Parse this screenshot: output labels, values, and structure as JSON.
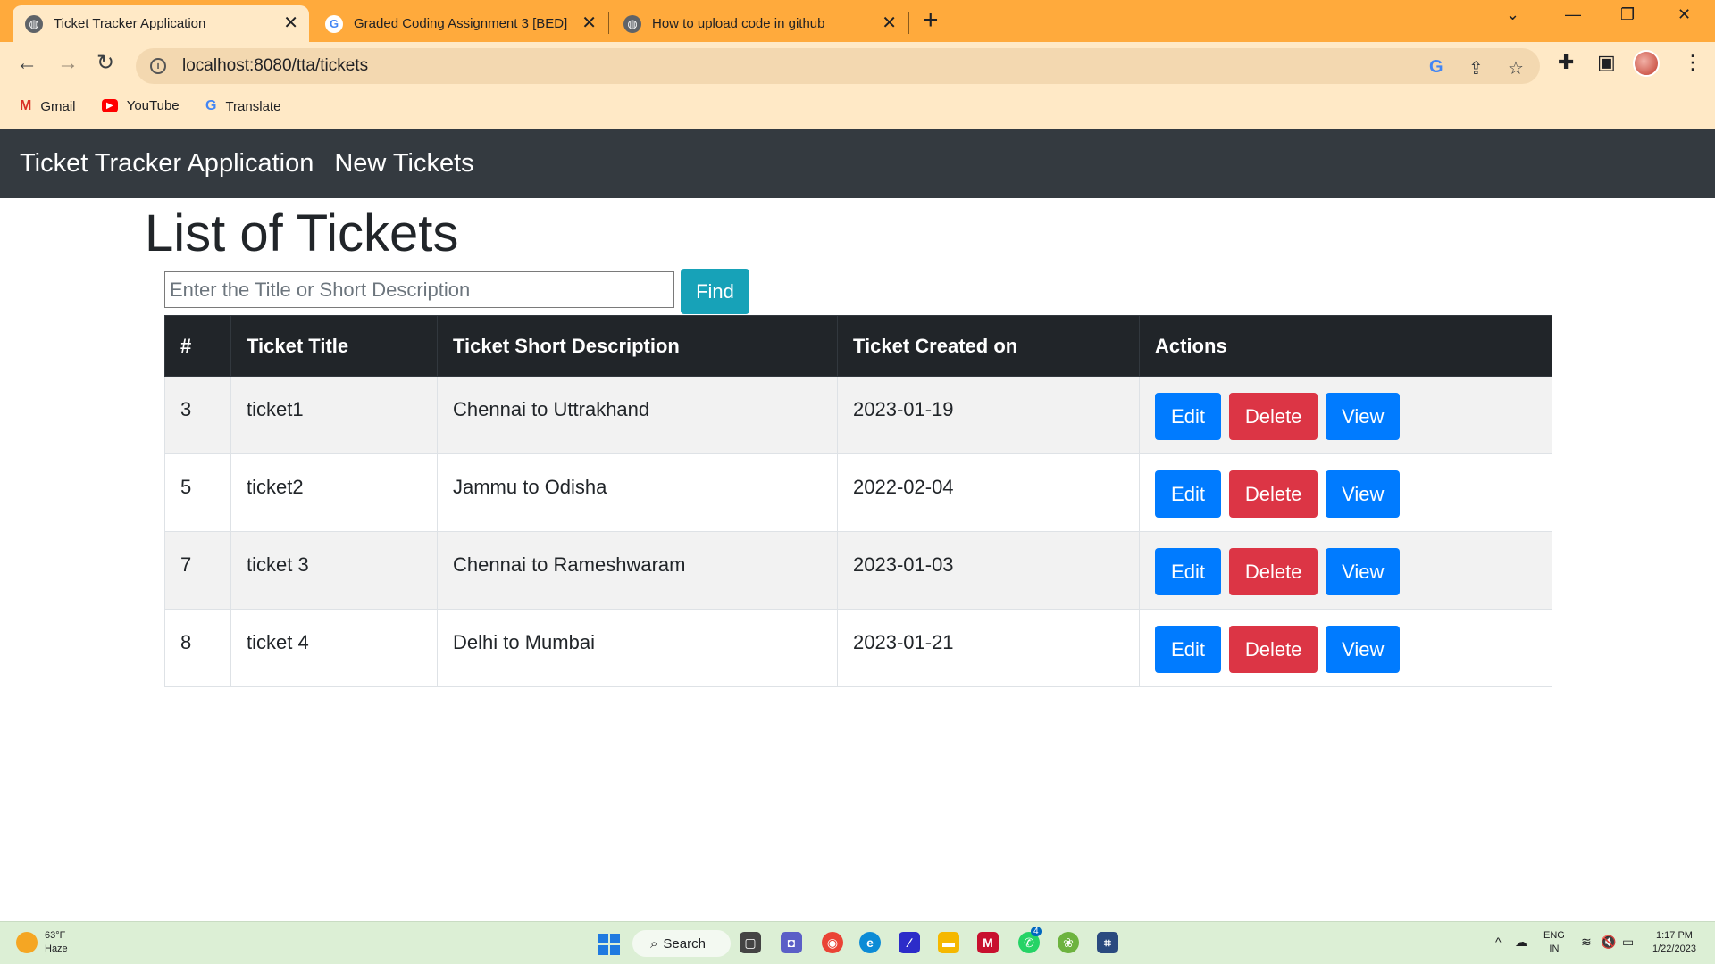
{
  "browser": {
    "tabs": [
      {
        "title": "Ticket Tracker Application",
        "icon": "globe-icon",
        "active": true
      },
      {
        "title": "Graded Coding Assignment 3 [BED]",
        "icon": "google-icon",
        "active": false
      },
      {
        "title": "How to upload code in github",
        "icon": "globe-icon",
        "active": false
      }
    ],
    "url": "localhost:8080/tta/tickets",
    "bookmarks": [
      {
        "label": "Gmail",
        "icon": "gmail-icon"
      },
      {
        "label": "YouTube",
        "icon": "youtube-icon"
      },
      {
        "label": "Translate",
        "icon": "translate-icon"
      }
    ],
    "colors": {
      "tabstrip": "#ffaa3c",
      "toolbar": "#ffe9c6"
    }
  },
  "navbar": {
    "brand": "Ticket Tracker Application",
    "links": [
      "New Tickets"
    ],
    "color": "#343a40"
  },
  "page": {
    "title": "List of Tickets",
    "search": {
      "placeholder": "Enter the Title or Short Description",
      "value": "",
      "button": "Find"
    }
  },
  "table": {
    "headers": [
      "#",
      "Ticket Title",
      "Ticket Short Description",
      "Ticket Created on",
      "Actions"
    ],
    "rows": [
      {
        "id": "3",
        "title": "ticket1",
        "description": "Chennai to Uttrakhand",
        "created": "2023-01-19"
      },
      {
        "id": "5",
        "title": "ticket2",
        "description": "Jammu to Odisha",
        "created": "2022-02-04"
      },
      {
        "id": "7",
        "title": "ticket 3",
        "description": "Chennai to Rameshwaram",
        "created": "2023-01-03"
      },
      {
        "id": "8",
        "title": "ticket 4",
        "description": "Delhi to Mumbai",
        "created": "2023-01-21"
      }
    ],
    "actions": {
      "edit": "Edit",
      "delete": "Delete",
      "view": "View"
    },
    "colors": {
      "edit": "#007bff",
      "delete": "#dc3545",
      "view": "#007bff",
      "find": "#17a2b8"
    }
  },
  "taskbar": {
    "weather": {
      "temp": "63°F",
      "condition": "Haze"
    },
    "search_label": "Search",
    "language": {
      "line1": "ENG",
      "line2": "IN"
    },
    "clock": {
      "time": "1:17 PM",
      "date": "1/22/2023"
    },
    "badges": {
      "chat": "4"
    }
  }
}
